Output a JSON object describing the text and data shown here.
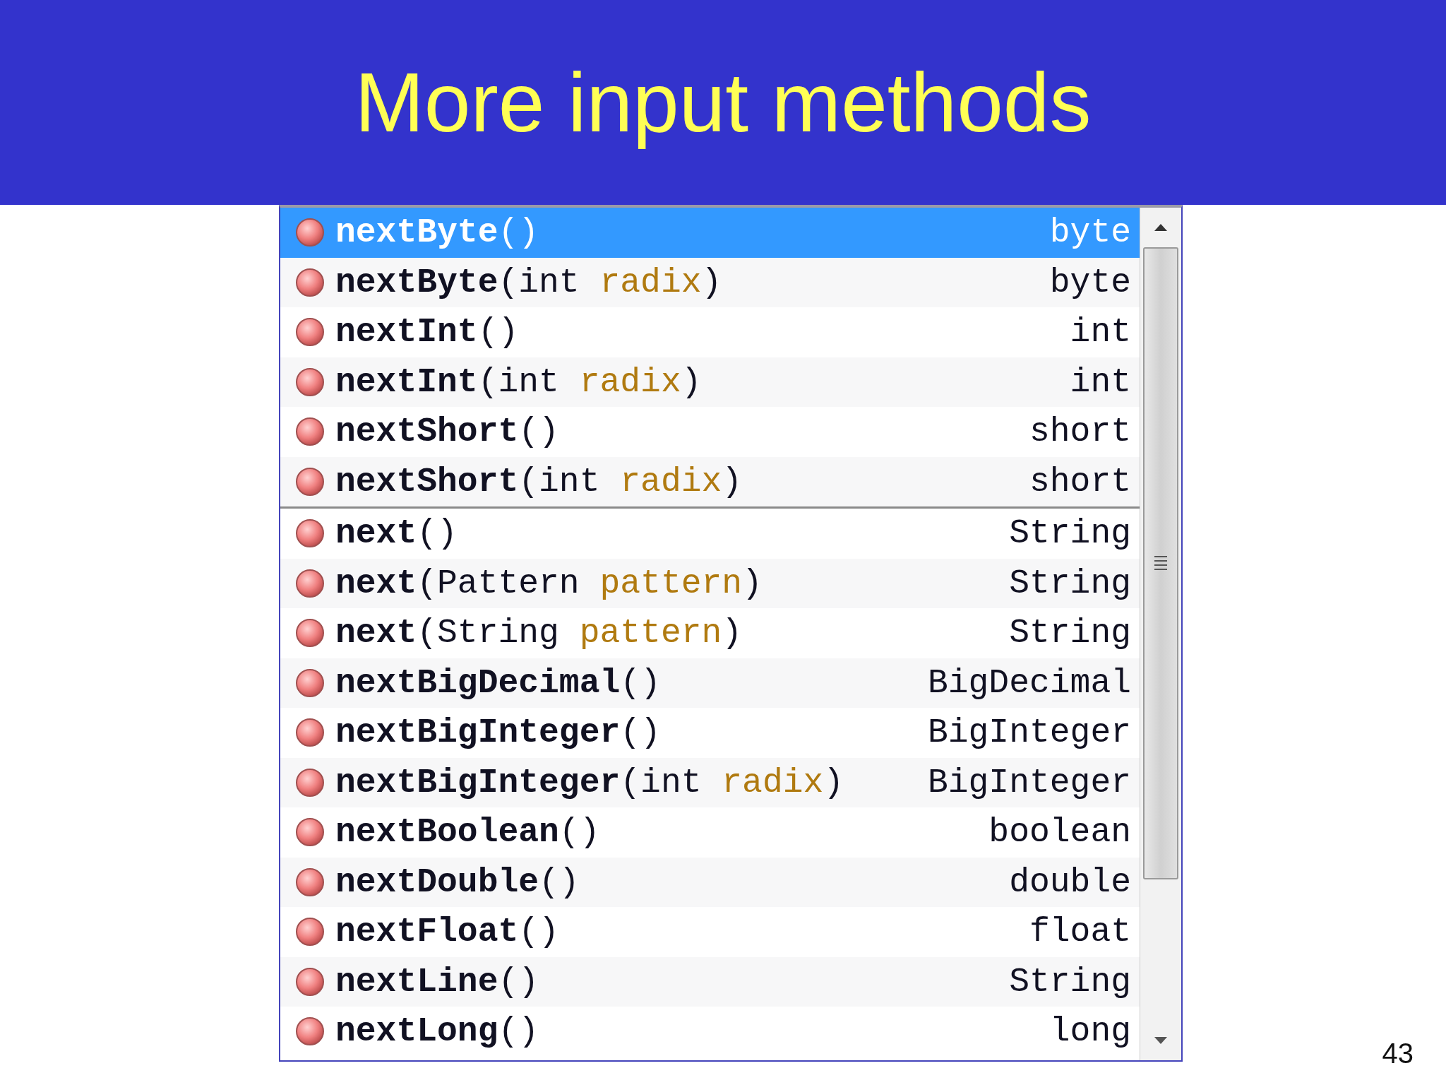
{
  "slide": {
    "title": "More input methods",
    "page_number": "43"
  },
  "completion_list": {
    "groups": [
      {
        "items": [
          {
            "signature": [
              {
                "kind": "method",
                "text": "nextByte"
              },
              {
                "kind": "plain",
                "text": "()"
              }
            ],
            "return_type": "byte",
            "selected": true
          },
          {
            "signature": [
              {
                "kind": "method",
                "text": "nextByte"
              },
              {
                "kind": "plain",
                "text": "(int "
              },
              {
                "kind": "param",
                "text": "radix"
              },
              {
                "kind": "plain",
                "text": ")"
              }
            ],
            "return_type": "byte",
            "selected": false
          },
          {
            "signature": [
              {
                "kind": "method",
                "text": "nextInt"
              },
              {
                "kind": "plain",
                "text": "()"
              }
            ],
            "return_type": "int",
            "selected": false
          },
          {
            "signature": [
              {
                "kind": "method",
                "text": "nextInt"
              },
              {
                "kind": "plain",
                "text": "(int "
              },
              {
                "kind": "param",
                "text": "radix"
              },
              {
                "kind": "plain",
                "text": ")"
              }
            ],
            "return_type": "int",
            "selected": false
          },
          {
            "signature": [
              {
                "kind": "method",
                "text": "nextShort"
              },
              {
                "kind": "plain",
                "text": "()"
              }
            ],
            "return_type": "short",
            "selected": false
          },
          {
            "signature": [
              {
                "kind": "method",
                "text": "nextShort"
              },
              {
                "kind": "plain",
                "text": "(int "
              },
              {
                "kind": "param",
                "text": "radix"
              },
              {
                "kind": "plain",
                "text": ")"
              }
            ],
            "return_type": "short",
            "selected": false
          }
        ]
      },
      {
        "items": [
          {
            "signature": [
              {
                "kind": "method",
                "text": "next"
              },
              {
                "kind": "plain",
                "text": "()"
              }
            ],
            "return_type": "String",
            "selected": false
          },
          {
            "signature": [
              {
                "kind": "method",
                "text": "next"
              },
              {
                "kind": "plain",
                "text": "(Pattern "
              },
              {
                "kind": "param",
                "text": "pattern"
              },
              {
                "kind": "plain",
                "text": ")"
              }
            ],
            "return_type": "String",
            "selected": false
          },
          {
            "signature": [
              {
                "kind": "method",
                "text": "next"
              },
              {
                "kind": "plain",
                "text": "(String "
              },
              {
                "kind": "param",
                "text": "pattern"
              },
              {
                "kind": "plain",
                "text": ")"
              }
            ],
            "return_type": "String",
            "selected": false
          },
          {
            "signature": [
              {
                "kind": "method",
                "text": "nextBigDecimal"
              },
              {
                "kind": "plain",
                "text": "()"
              }
            ],
            "return_type": "BigDecimal",
            "selected": false
          },
          {
            "signature": [
              {
                "kind": "method",
                "text": "nextBigInteger"
              },
              {
                "kind": "plain",
                "text": "()"
              }
            ],
            "return_type": "BigInteger",
            "selected": false
          },
          {
            "signature": [
              {
                "kind": "method",
                "text": "nextBigInteger"
              },
              {
                "kind": "plain",
                "text": "(int "
              },
              {
                "kind": "param",
                "text": "radix"
              },
              {
                "kind": "plain",
                "text": ")"
              }
            ],
            "return_type": "BigInteger",
            "selected": false
          },
          {
            "signature": [
              {
                "kind": "method",
                "text": "nextBoolean"
              },
              {
                "kind": "plain",
                "text": "()"
              }
            ],
            "return_type": "boolean",
            "selected": false
          },
          {
            "signature": [
              {
                "kind": "method",
                "text": "nextDouble"
              },
              {
                "kind": "plain",
                "text": "()"
              }
            ],
            "return_type": "double",
            "selected": false
          },
          {
            "signature": [
              {
                "kind": "method",
                "text": "nextFloat"
              },
              {
                "kind": "plain",
                "text": "()"
              }
            ],
            "return_type": "float",
            "selected": false
          },
          {
            "signature": [
              {
                "kind": "method",
                "text": "nextLine"
              },
              {
                "kind": "plain",
                "text": "()"
              }
            ],
            "return_type": "String",
            "selected": false
          },
          {
            "signature": [
              {
                "kind": "method",
                "text": "nextLong"
              },
              {
                "kind": "plain",
                "text": "()"
              }
            ],
            "return_type": "long",
            "selected": false
          }
        ]
      }
    ]
  }
}
